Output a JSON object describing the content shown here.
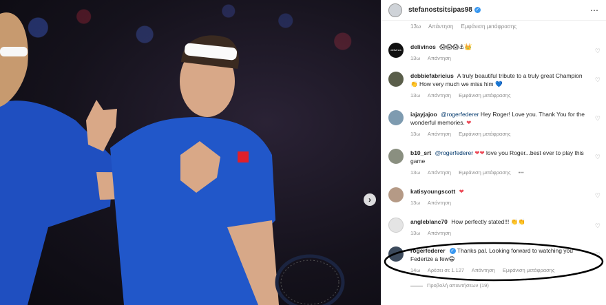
{
  "post": {
    "author": "stefanostsitsipas98",
    "more_icon": "⋯",
    "next_icon": "›"
  },
  "top_meta": {
    "time": "13ω",
    "reply": "Απάντηση",
    "translate": "Εμφάνιση μετάφρασης"
  },
  "comments": [
    {
      "user": "delivinos",
      "avatar_text": "delivinos",
      "text": "😱😱😱⚓👑",
      "time": "13ω",
      "likes": "",
      "reply": "Απάντηση",
      "translate": "",
      "more": ""
    },
    {
      "user": "debbiefabricius",
      "text": "A truly beautiful tribute to a truly great Champion 👏 How very much we miss him",
      "heart": "💙",
      "time": "13ω",
      "likes": "",
      "reply": "Απάντηση",
      "translate": "Εμφάνιση μετάφρασης",
      "more": ""
    },
    {
      "user": "iajayjajoo",
      "mention": "@rogerfederer",
      "text": "Hey Roger! Love you. Thank You for the wonderful memories.",
      "heart": "❤",
      "time": "13ω",
      "likes": "",
      "reply": "Απάντηση",
      "translate": "Εμφάνιση μετάφρασης",
      "more": ""
    },
    {
      "user": "b10_srt",
      "mention": "@rogerfederer",
      "hearts": "❤❤",
      "text": "love you Roger...best ever to play this game",
      "time": "13ω",
      "likes": "",
      "reply": "Απάντηση",
      "translate": "Εμφάνιση μετάφρασης",
      "more": "•••"
    },
    {
      "user": "katisyoungscott",
      "heart": "❤",
      "text": "",
      "time": "13ω",
      "likes": "",
      "reply": "Απάντηση",
      "translate": "",
      "more": ""
    },
    {
      "user": "angleblanc70",
      "text": "How perfectly stated!!! 👏👏",
      "time": "13ω",
      "likes": "",
      "reply": "Απάντηση",
      "translate": "",
      "more": ""
    },
    {
      "user": "rogerfederer",
      "verified": true,
      "text": "Thanks pal. Looking forward to watching you Federize a few😁",
      "time": "14ω",
      "likes": "Αρέσει σε 1.127",
      "reply": "Απάντηση",
      "translate": "Εμφάνιση μετάφρασης",
      "more": ""
    }
  ],
  "view_replies": "Προβολή απαντήσεων (19)",
  "colors": {
    "accent": "#3897f0",
    "heart_red": "#ed4956",
    "player_shirt": "#1f54c4",
    "annotation": "#000000"
  }
}
